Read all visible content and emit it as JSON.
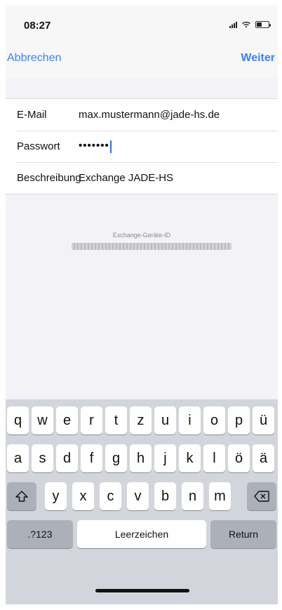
{
  "status_bar": {
    "time": "08:27"
  },
  "nav": {
    "cancel_label": "Abbrechen",
    "next_label": "Weiter"
  },
  "form": {
    "email": {
      "label": "E-Mail",
      "value": "max.mustermann@jade-hs.de"
    },
    "password": {
      "label": "Passwort",
      "value": "•••••••"
    },
    "description": {
      "label": "Beschreibung",
      "value": "Exchange JADE-HS"
    }
  },
  "device": {
    "label": "Exchange-Geräte-ID"
  },
  "keyboard": {
    "row1": [
      "q",
      "w",
      "e",
      "r",
      "t",
      "z",
      "u",
      "i",
      "o",
      "p",
      "ü"
    ],
    "row2": [
      "a",
      "s",
      "d",
      "f",
      "g",
      "h",
      "j",
      "k",
      "l",
      "ö",
      "ä"
    ],
    "row3": [
      "y",
      "x",
      "c",
      "v",
      "b",
      "n",
      "m"
    ],
    "numbers_label": ".?123",
    "space_label": "Leerzeichen",
    "return_label": "Return"
  }
}
